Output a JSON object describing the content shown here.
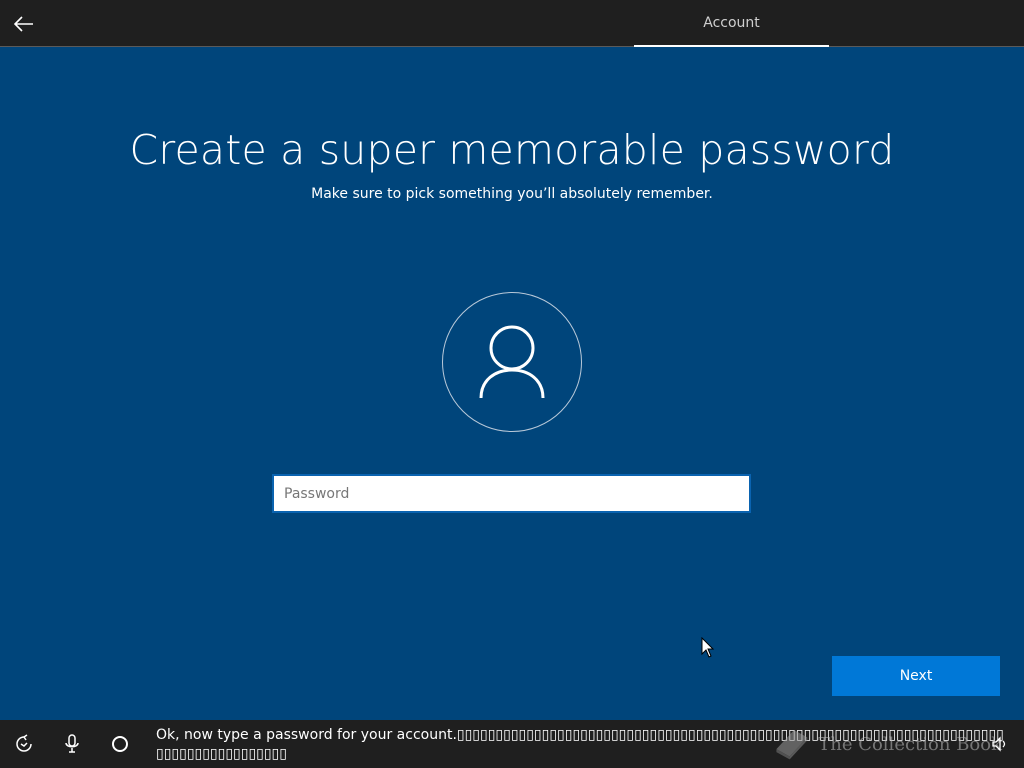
{
  "header": {
    "tab_label": "Account"
  },
  "main": {
    "title": "Create a super memorable password",
    "subtitle": "Make sure to pick something you’ll absolutely remember.",
    "password": {
      "placeholder": "Password",
      "value": ""
    },
    "next_label": "Next"
  },
  "bottom_bar": {
    "cortana_text": "Ok, now type a password for your account.▯▯▯▯▯▯▯▯▯▯▯▯▯▯▯▯▯▯▯▯▯▯▯▯▯▯▯▯▯▯▯▯▯▯▯▯▯▯▯▯▯▯▯▯▯▯▯▯▯▯▯▯▯▯▯▯▯▯▯▯▯▯▯▯▯▯▯▯▯▯▯▯▯▯▯▯▯▯▯▯▯▯▯▯▯▯▯▯",
    "watermark_text": "The Collection Book",
    "icons": [
      "accessibility-icon",
      "microphone-icon",
      "cortana-icon",
      "volume-icon"
    ]
  },
  "colors": {
    "background": "#00457b",
    "topbar": "#1f1f1f",
    "accent": "#0078d7",
    "field_border": "#0a63b0"
  }
}
